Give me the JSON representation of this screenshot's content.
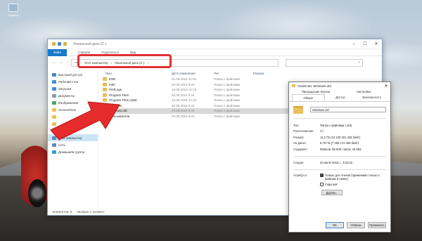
{
  "desktop": {
    "icon_label": "Корзина"
  },
  "explorer": {
    "title": "Локальный диск (C:)",
    "ribbon_tabs": [
      "Файл",
      "Главная",
      "Поделиться",
      "Вид"
    ],
    "address_path": [
      "Этот компьютер",
      "Локальный диск (C:)"
    ],
    "search_placeholder": "",
    "columns": {
      "name": "Имя",
      "date": "Дата изменения",
      "type": "Тип",
      "size": "Размер"
    },
    "nav_items": [
      {
        "label": "Быстрый доступ",
        "icon": "star-icon",
        "color": "#4a84c6"
      },
      {
        "label": "Рабочий стол",
        "icon": "desktop-icon",
        "color": "#3f8fd8"
      },
      {
        "label": "Загрузки",
        "icon": "download-icon",
        "color": "#3f8fd8"
      },
      {
        "label": "Документы",
        "icon": "documents-icon",
        "color": "#8a9bb0"
      },
      {
        "label": "Изображения",
        "icon": "pictures-icon",
        "color": "#4aa56a"
      },
      {
        "label": "Screenshots",
        "icon": "folder-icon",
        "color": "#e8c25a"
      },
      {
        "label": "",
        "icon": "folder-icon",
        "color": "#e8c25a"
      },
      {
        "label": "",
        "icon": "folder-icon",
        "color": "#e8c25a"
      },
      {
        "label": "OneDrive",
        "icon": "cloud-icon",
        "color": "#4a84c6"
      },
      {
        "label": "Этот компьютер",
        "icon": "computer-icon",
        "color": "#5b8cc4"
      },
      {
        "label": "Сеть",
        "icon": "network-icon",
        "color": "#5b8cc4"
      },
      {
        "label": "Домашняя группа",
        "icon": "homegroup-icon",
        "color": "#3a9ad8"
      }
    ],
    "files": [
      {
        "name": "ESD",
        "date": "01.08.2016 21:06",
        "type": "Папка с файлами"
      },
      {
        "name": "Intel",
        "date": "20.08.2015 9:20",
        "type": "Папка с файлами"
      },
      {
        "name": "PerfLogs",
        "date": "16.08.2016 12:19",
        "type": "Папка с файлами"
      },
      {
        "name": "Program Files",
        "date": "20.08.2016 9:24",
        "type": "Папка с файлами"
      },
      {
        "name": "Program Files (x86)",
        "date": "18.08.2016 12:19",
        "type": "Папка с файлами"
      },
      {
        "name": "Windows",
        "date": "20.08.2016 9:24",
        "type": "Папка с файлами"
      },
      {
        "name": "Windows.old",
        "date": "20.08.2016 9:20",
        "type": "Папка с файлами"
      },
      {
        "name": "Пользователи",
        "date": "20.08.2016 9:23",
        "type": "Папка с файлами"
      }
    ],
    "status": {
      "items": "Элементов: 8",
      "selected": "Выбран 1 элемент"
    }
  },
  "properties": {
    "title": "Свойства: Windows.old",
    "tabs_top": [
      "Предыдущие версии",
      "Настройка"
    ],
    "tabs": [
      "Общие",
      "Доступ",
      "Безопасность"
    ],
    "active_tab": "Общие",
    "name_value": "Windows.old",
    "rows_a": [
      {
        "label": "Тип:",
        "value": "Папка с файлами (.old)"
      },
      {
        "label": "Расположение:",
        "value": "C:\\"
      },
      {
        "label": "Размер:",
        "value": "11,2 ГБ (12 120 201 425 байт)"
      },
      {
        "label": "На диске:",
        "value": "6,75 ГБ (7 258 174 456 байт)"
      },
      {
        "label": "Содержит:",
        "value": "Файлов: 86 605; папок: 19 684"
      }
    ],
    "rows_b": [
      {
        "label": "Создан:",
        "value": "20 июля 2016 г., 3:32:32"
      }
    ],
    "attributes_label": "Атрибуты:",
    "readonly_label": "Только для чтения (применимо только к файлам в папке)",
    "hidden_label": "Скрытый",
    "other_button": "Другие...",
    "buttons": [
      "OK",
      "Отмена",
      "Применить"
    ]
  }
}
